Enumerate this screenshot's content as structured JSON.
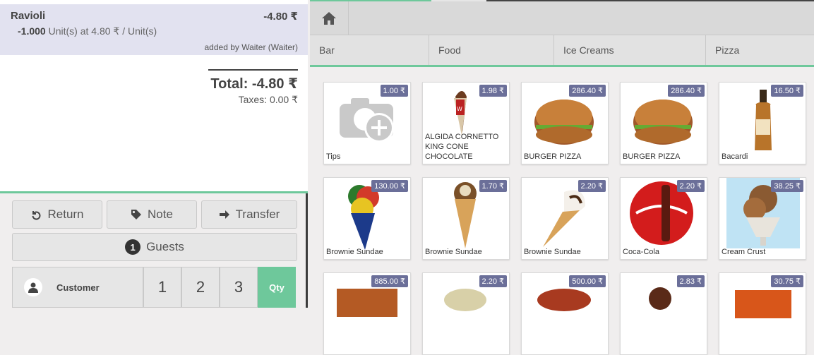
{
  "order": {
    "line": {
      "name": "Ravioli",
      "price": "-4.80 ₹",
      "qty": "-1.000",
      "unit_info": "Unit(s) at 4.80 ₹ / Unit(s)",
      "added_by": "added by Waiter (Waiter)"
    },
    "total": "Total: -4.80 ₹",
    "taxes": "Taxes: 0.00 ₹"
  },
  "controls": {
    "return_label": "Return",
    "note_label": "Note",
    "transfer_label": "Transfer",
    "guests_count": "1",
    "guests_label": "Guests",
    "customer_label": "Customer",
    "keys": [
      "1",
      "2",
      "3"
    ],
    "qty_label": "Qty"
  },
  "categories": [
    "Bar",
    "Food",
    "Ice Creams",
    "Pizza"
  ],
  "products": [
    {
      "name": "Tips",
      "price": "1.00 ₹"
    },
    {
      "name": "ALGIDA CORNETTO KING CONE CHOCOLATE",
      "price": "1.98 ₹"
    },
    {
      "name": "BURGER PIZZA",
      "price": "286.40 ₹"
    },
    {
      "name": "BURGER PIZZA",
      "price": "286.40 ₹"
    },
    {
      "name": "Bacardi",
      "price": "16.50 ₹"
    },
    {
      "name": "Brownie Sundae",
      "price": "130.00 ₹"
    },
    {
      "name": "Brownie Sundae",
      "price": "1.70 ₹"
    },
    {
      "name": "Brownie Sundae",
      "price": "2.20 ₹"
    },
    {
      "name": "Coca-Cola",
      "price": "2.20 ₹"
    },
    {
      "name": "Cream Crust",
      "price": "38.25 ₹"
    },
    {
      "name": "",
      "price": "885.00 ₹"
    },
    {
      "name": "",
      "price": "2.20 ₹"
    },
    {
      "name": "",
      "price": "500.00 ₹"
    },
    {
      "name": "",
      "price": "2.83 ₹"
    },
    {
      "name": "",
      "price": "30.75 ₹"
    }
  ],
  "colors": {
    "accent": "#6ec89b",
    "price_badge": "#6b6f99",
    "selected_line": "#e2e2f0"
  }
}
